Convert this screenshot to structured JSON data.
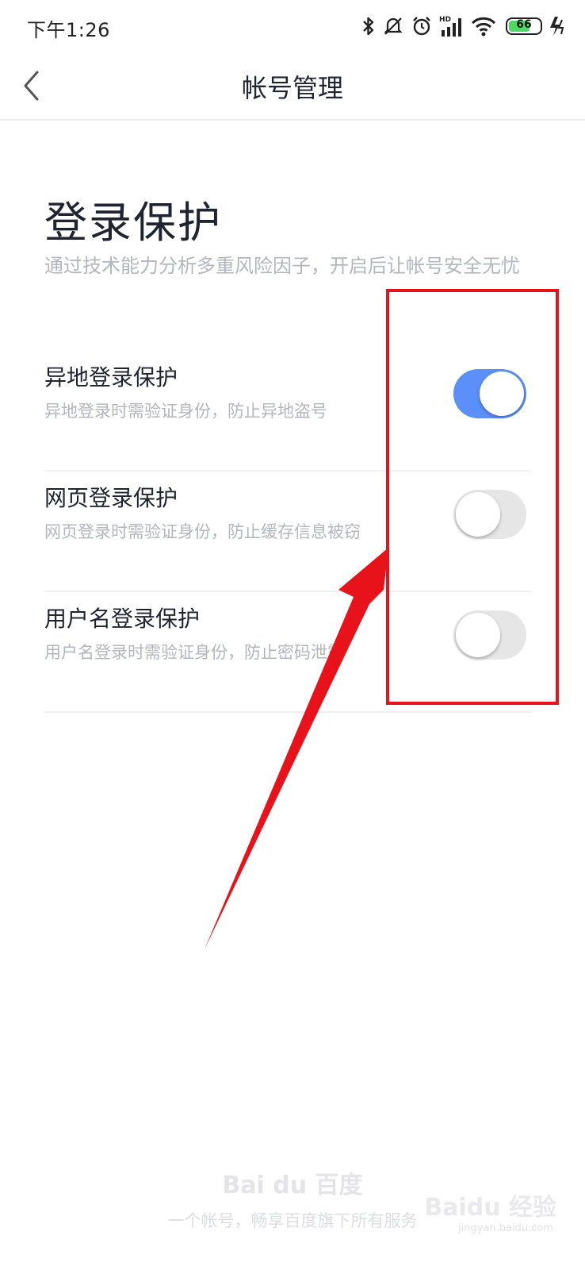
{
  "status_bar": {
    "time": "下午1:26",
    "battery_level": "66",
    "icons": [
      "bluetooth-icon",
      "mute-icon",
      "alarm-icon",
      "hd-signal-icon",
      "wifi-icon",
      "battery-icon",
      "charging-icon"
    ]
  },
  "nav": {
    "back_icon": "chevron-left-icon",
    "title": "帐号管理"
  },
  "section": {
    "title": "登录保护",
    "description": "通过技术能力分析多重风险因子，开启后让帐号安全无忧"
  },
  "settings": [
    {
      "title": "异地登录保护",
      "description": "异地登录时需验证身份，防止异地盗号",
      "enabled": true
    },
    {
      "title": "网页登录保护",
      "description": "网页登录时需验证身份，防止缓存信息被窃",
      "enabled": false
    },
    {
      "title": "用户名登录保护",
      "description": "用户名登录时需验证身份，防止密码泄露",
      "enabled": false
    }
  ],
  "footer": {
    "logo_text": "Bai du 百度",
    "slogan": "一个帐号，畅享百度旗下所有服务"
  },
  "watermark": {
    "text": "Baidu 经验",
    "sub": "jingyan.baidu.com"
  },
  "colors": {
    "switch_on": "#5b8ff9",
    "switch_off": "#e6e6e6",
    "annotation_red": "#e8131a"
  }
}
